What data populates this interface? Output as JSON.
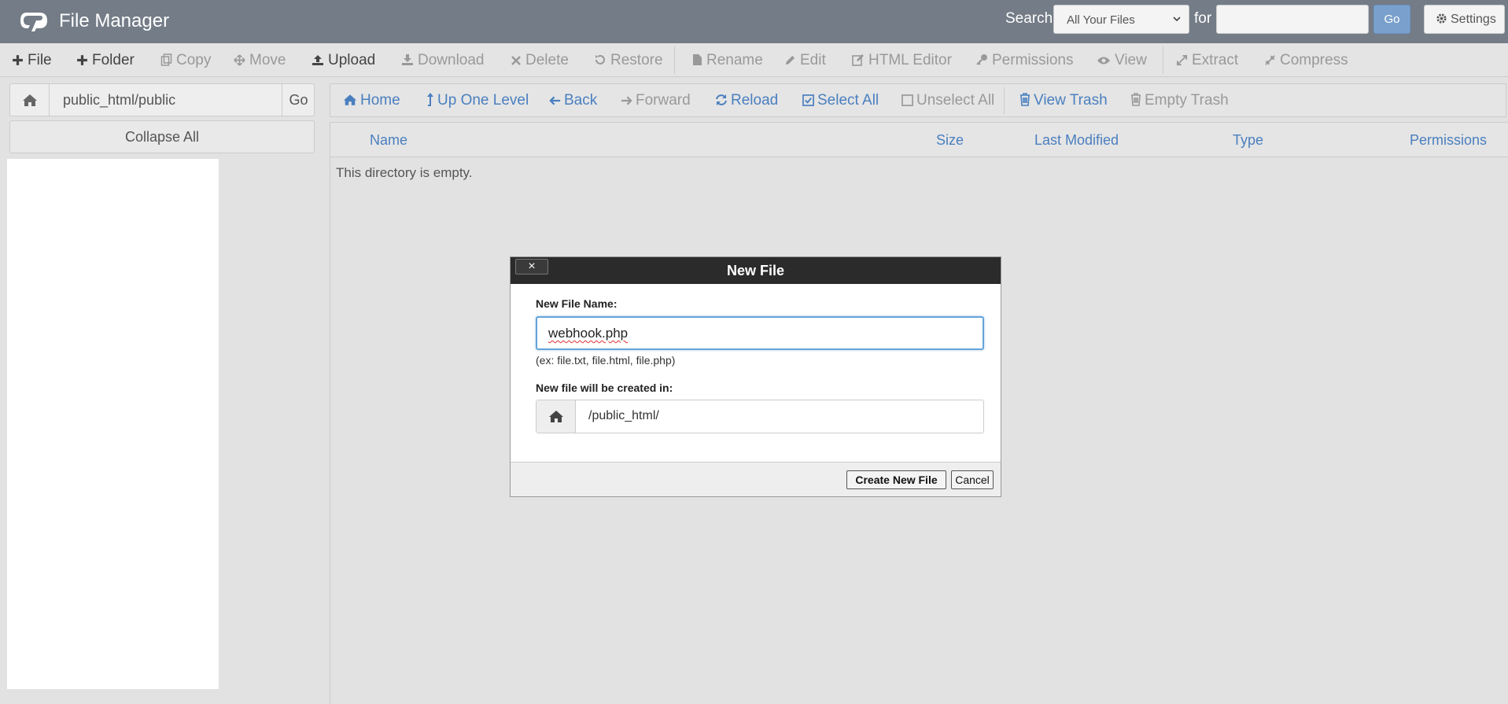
{
  "header": {
    "title": "File Manager",
    "search_label": "Search",
    "search_scope": "All Your Files",
    "for_label": "for",
    "search_value": "",
    "go_label": "Go",
    "settings_label": "Settings"
  },
  "toolbar": {
    "file": "File",
    "folder": "Folder",
    "copy": "Copy",
    "move": "Move",
    "upload": "Upload",
    "download": "Download",
    "delete": "Delete",
    "restore": "Restore",
    "rename": "Rename",
    "edit": "Edit",
    "html_editor": "HTML Editor",
    "permissions": "Permissions",
    "view": "View",
    "extract": "Extract",
    "compress": "Compress"
  },
  "sidebar": {
    "path_value": "public_html/public",
    "go_label": "Go",
    "collapse_label": "Collapse All"
  },
  "nav": {
    "home": "Home",
    "up": "Up One Level",
    "back": "Back",
    "forward": "Forward",
    "reload": "Reload",
    "select_all": "Select All",
    "unselect_all": "Unselect All",
    "view_trash": "View Trash",
    "empty_trash": "Empty Trash"
  },
  "table": {
    "columns": [
      "Name",
      "Size",
      "Last Modified",
      "Type",
      "Permissions"
    ],
    "empty_message": "This directory is empty."
  },
  "dialog": {
    "title": "New File",
    "close": "×",
    "name_label": "New File Name:",
    "name_value": "webhook.php",
    "hint": "(ex: file.txt, file.html, file.php)",
    "dir_label": "New file will be created in:",
    "dir_value": "/public_html/",
    "create_label": "Create New File",
    "cancel_label": "Cancel"
  }
}
